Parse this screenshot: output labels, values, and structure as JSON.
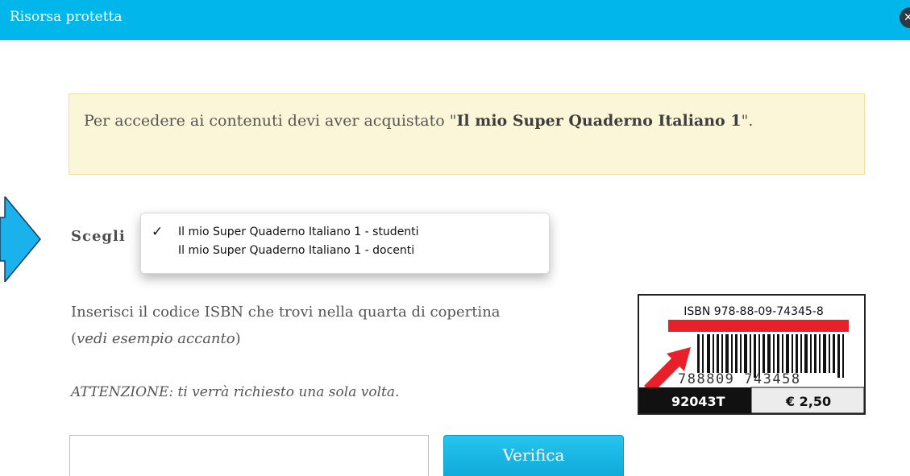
{
  "dialog": {
    "title": "Risorsa protetta",
    "close_icon": "close-icon"
  },
  "notice": {
    "text_before": "Per accedere ai contenuti devi aver acquistato \"",
    "product": "Il mio Super Quaderno Italiano 1",
    "text_after": "\"."
  },
  "choose": {
    "label": "Scegli",
    "options": [
      {
        "label": "Il mio Super Quaderno Italiano 1 - studenti",
        "selected": true,
        "mark": "✓"
      },
      {
        "label": "Il mio Super Quaderno Italiano 1 - docenti",
        "selected": false,
        "mark": ""
      }
    ]
  },
  "instructions": {
    "line": "Inserisci il codice ISBN che trovi nella quarta di copertina",
    "example_note": "vedi esempio accanto",
    "paren_open": "(",
    "paren_close": ")"
  },
  "warning": "ATTENZIONE: ti verrà richiesto una sola volta.",
  "isbn_example": {
    "isbn_label": "ISBN 978-88-09-74345-8",
    "barcode_digits": "788809 743458",
    "code": "92043T",
    "price": "€ 2,50"
  },
  "form": {
    "input_value": "",
    "verify_label": "Verifica"
  },
  "colors": {
    "header": "#00b6eb",
    "notice_bg": "#fcf6d9",
    "button": "#15b0de",
    "barcode_highlight": "#e8202a"
  }
}
